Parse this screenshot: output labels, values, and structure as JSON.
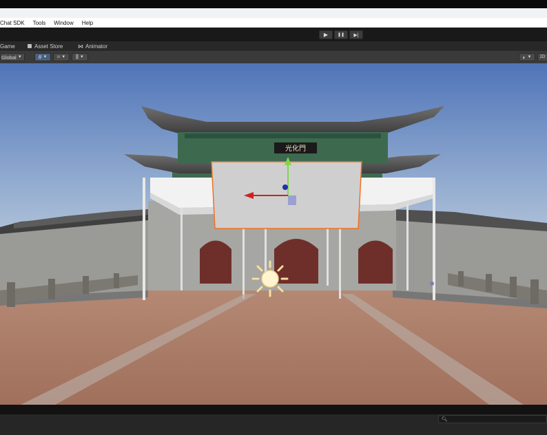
{
  "menu": {
    "items": [
      "Chat SDK",
      "Tools",
      "Window",
      "Help"
    ]
  },
  "playmode": {
    "play_icon": "▶",
    "pause_icon": "❚❚",
    "step_icon": "▶|"
  },
  "tabs": {
    "game": "Game",
    "asset_store": "Asset Store",
    "animator": "Animator"
  },
  "toolbar": {
    "pivot_space": "Global",
    "right_label": "2D"
  },
  "scene": {
    "signboard": "光化門"
  },
  "icons": {
    "asset_store": "shopping-bag-icon",
    "animator": "animator-icon",
    "grid": "grid-icon",
    "snap": "snap-icon",
    "increment": "increment-icon",
    "gizmo": "gizmo-icon",
    "sun": "directional-light-icon",
    "search": "search-icon"
  },
  "colors": {
    "sky_top": "#4f74b8",
    "sky_bottom": "#b7c8dc",
    "ground": "#a87a64",
    "selection_outline": "#f07020",
    "gizmo_y": "#7fd84a",
    "gizmo_x": "#d02020",
    "gizmo_z": "#2040c0"
  }
}
